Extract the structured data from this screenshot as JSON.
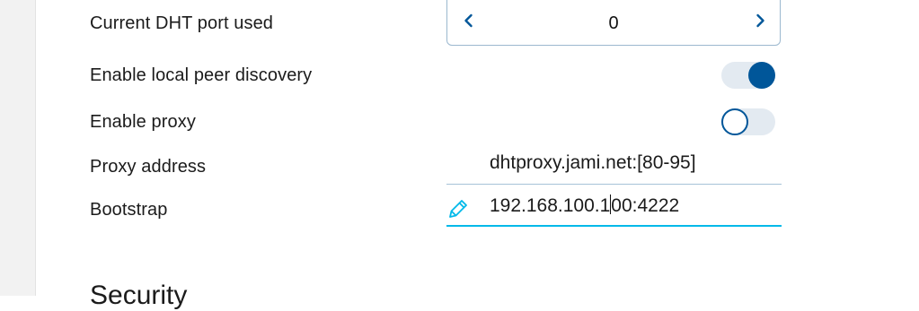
{
  "settings": {
    "dht_port": {
      "label": "Current DHT port used",
      "value": "0"
    },
    "local_peer_discovery": {
      "label": "Enable local peer discovery",
      "enabled": true
    },
    "proxy": {
      "label": "Enable proxy",
      "enabled": false
    },
    "proxy_address": {
      "label": "Proxy address",
      "value": "dhtproxy.jami.net:[80-95]"
    },
    "bootstrap": {
      "label": "Bootstrap",
      "value_before_caret": "192.168.100.1",
      "value_after_caret": "00:4222"
    }
  },
  "next_section": {
    "title": "Security"
  },
  "icons": {
    "decrement": "chevron-left-icon",
    "increment": "chevron-right-icon",
    "edit": "pencil-icon"
  },
  "colors": {
    "accent": "#005699",
    "focus_underline": "#03b9e9",
    "toggle_track": "#e3eaf1"
  }
}
